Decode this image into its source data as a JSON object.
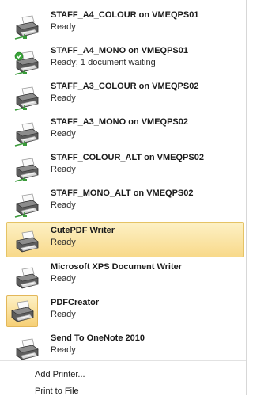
{
  "printers": [
    {
      "name": "STAFF_A4_COLOUR on VMEQPS01",
      "status": "Ready",
      "icon": "network-printer-icon",
      "default": false
    },
    {
      "name": "STAFF_A4_MONO on VMEQPS01",
      "status": "Ready; 1 document waiting",
      "icon": "network-printer-icon",
      "default": true
    },
    {
      "name": "STAFF_A3_COLOUR on VMEQPS02",
      "status": "Ready",
      "icon": "network-printer-icon",
      "default": false
    },
    {
      "name": "STAFF_A3_MONO on VMEQPS02",
      "status": "Ready",
      "icon": "network-printer-icon",
      "default": false
    },
    {
      "name": "STAFF_COLOUR_ALT on VMEQPS02",
      "status": "Ready",
      "icon": "network-printer-icon",
      "default": false
    },
    {
      "name": "STAFF_MONO_ALT on VMEQPS02",
      "status": "Ready",
      "icon": "network-printer-icon",
      "default": false
    },
    {
      "name": "CutePDF Writer",
      "status": "Ready",
      "icon": "printer-icon",
      "default": false,
      "selected": true
    },
    {
      "name": "Microsoft XPS Document Writer",
      "status": "Ready",
      "icon": "printer-icon",
      "default": false
    },
    {
      "name": "PDFCreator",
      "status": "Ready",
      "icon": "printer-icon",
      "default": false,
      "icon_highlighted": true
    },
    {
      "name": "Send To OneNote 2010",
      "status": "Ready",
      "icon": "printer-icon",
      "default": false
    }
  ],
  "actions": {
    "add_printer": "Add Printer...",
    "print_to_file": "Print to File"
  },
  "colors": {
    "selection_top": "#fdf1c5",
    "selection_bottom": "#f8d98a",
    "default_check": "#3aa63a",
    "network_cable": "#3a9a3a"
  }
}
